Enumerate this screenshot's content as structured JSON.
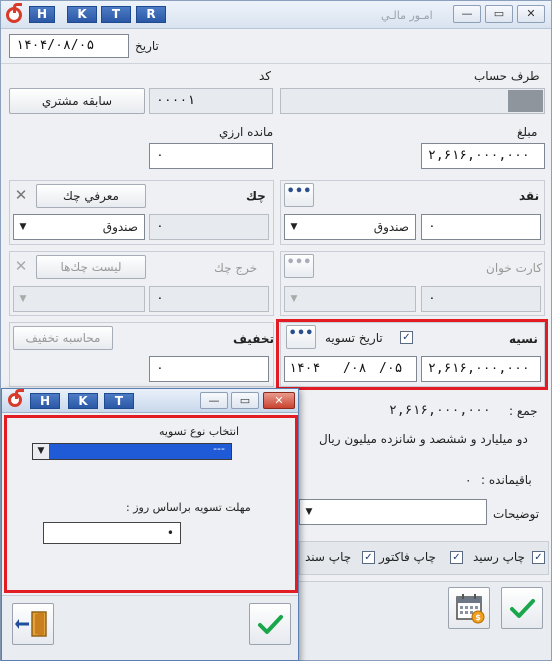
{
  "window": {
    "title": "امـور مالـي",
    "key_buttons": [
      "H",
      "K",
      "T",
      "R"
    ],
    "controls": {
      "min": "—",
      "restore": "▭",
      "close": "✕"
    }
  },
  "header": {
    "date_label": "تاريخ",
    "date_value": "۱۴۰۴/۰۸/۰۵"
  },
  "account": {
    "party_label": "طرف حساب",
    "code_label": "كد",
    "code_value": "۰۰۰۰۱",
    "history_button": "سابقه مشتري",
    "balance_label": "مانده ارزي",
    "balance_value": "۰",
    "amount_label": "مبلغ",
    "amount_value": "۲,۶۱۶,۰۰۰,۰۰۰"
  },
  "cash": {
    "label": "نقد",
    "value": "۰",
    "box_option": "صندوق",
    "dots": "•••"
  },
  "cheque": {
    "label": "چك",
    "intro_button": "معرفي چك",
    "value": "۰",
    "box_option": "صندوق"
  },
  "card": {
    "label": "كارت خوان",
    "value": "۰",
    "dots": "•••"
  },
  "cheque_out": {
    "label": "خرج چك",
    "list_button": "ليست چك‌ها",
    "value": "۰"
  },
  "credit": {
    "label": "نسيه",
    "settle_date_label": "تاريخ تسويه",
    "settle_checked": true,
    "dots": "•••",
    "amount": "۲,۶۱۶,۰۰۰,۰۰۰",
    "date_year": "۱۴۰۴",
    "date_month": "/۰۸",
    "date_day": "/۰۵"
  },
  "discount": {
    "label": "تخفيف",
    "calc_button": "محاسبه تخفيف",
    "value": "۰"
  },
  "summary": {
    "total_label": "جمع :",
    "total_value": "۲,۶۱۶,۰۰۰,۰۰۰",
    "total_words": "دو ميليارد  و ششصد و شانزده ميليون  ريال",
    "remaining_label": "باقيمانده :",
    "remaining_value": "۰",
    "notes_label": "توضيحات"
  },
  "print": {
    "receipt": "چاپ رسيد",
    "invoice": "چاپ فاكتور",
    "voucher": "چاپ سند"
  },
  "dialog": {
    "key_buttons": [
      "H",
      "K",
      "T"
    ],
    "controls": {
      "min": "—",
      "restore": "▭",
      "close": "✕"
    },
    "settle_type_label": "انتخاب نوع تسويه",
    "settle_type_value": "---",
    "days_label": "مهلت تسويه براساس روز :",
    "days_value": "•"
  },
  "colors": {
    "accent": "#e31b23",
    "brand": "#2a58a6",
    "confirm": "#1aa64a"
  }
}
